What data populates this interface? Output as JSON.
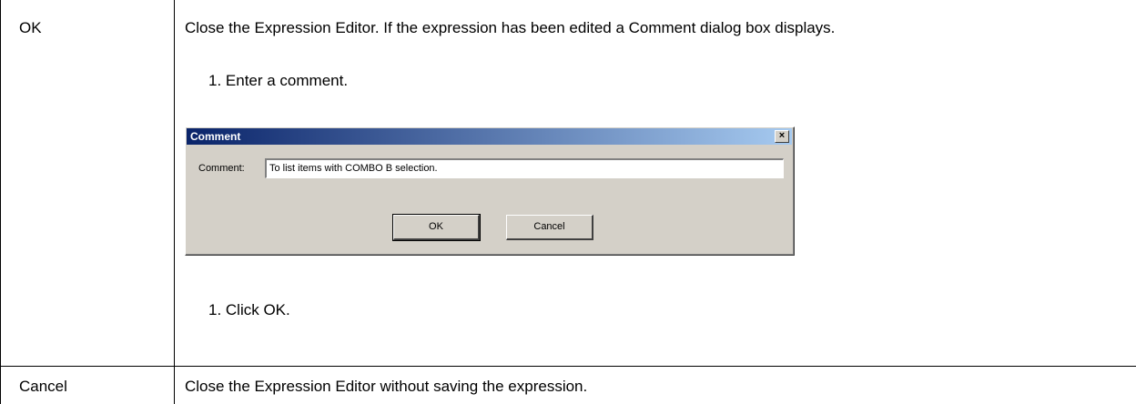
{
  "rows": [
    {
      "term": "OK",
      "description": "Close the Expression Editor. If the expression has been edited a Comment dialog box displays.",
      "step_1": "1. Enter a comment.",
      "step_2": "1. Click OK."
    },
    {
      "term": "Cancel",
      "description": "Close the Expression Editor without saving the expression."
    }
  ],
  "dialog": {
    "title": "Comment",
    "close_glyph": "×",
    "comment_label": "Comment:",
    "comment_value": "To list items with COMBO B selection.",
    "ok_label": "OK",
    "cancel_label": "Cancel"
  }
}
